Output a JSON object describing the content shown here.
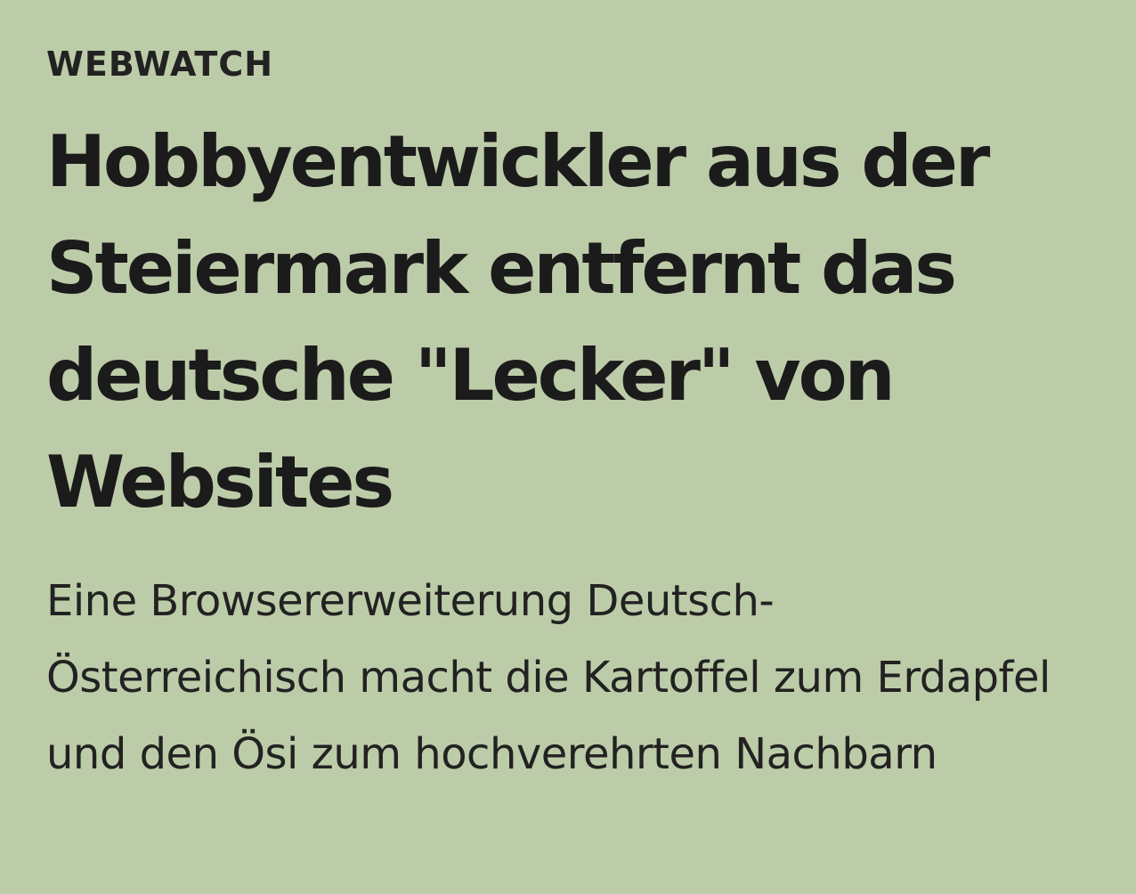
{
  "article": {
    "kicker": "WEBWATCH",
    "headline": "Hobbyentwickler aus der Steiermark entfernt das deutsche \"Lecker\" von Websites",
    "dek": "Eine Browsererweiterung Deutsch-Österreichisch macht die Kartoffel zum Erdapfel und den Ösi zum hochverehrten Nachbarn"
  },
  "colors": {
    "background": "#bdcca8",
    "text": "#1c1c1c"
  }
}
